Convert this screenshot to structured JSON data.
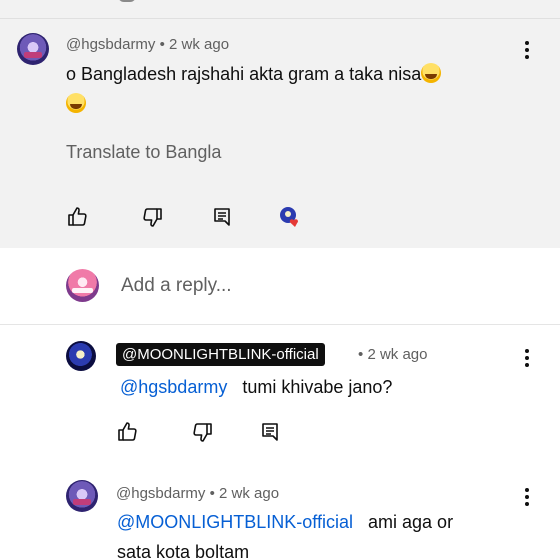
{
  "comment": {
    "author": "@hgsbdarmy",
    "time": "2 wk ago",
    "text_line1": "o Bangladesh rajshahi akta gram a taka nisa",
    "translate": "Translate to Bangla"
  },
  "reply_box": {
    "placeholder": "Add a reply..."
  },
  "replies": [
    {
      "author": "@MOONLIGHTBLINK-official",
      "time": "2 wk ago",
      "mention": "@hgsbdarmy",
      "text": "tumi khivabe jano?"
    },
    {
      "author": "@hgsbdarmy",
      "time": "2 wk ago",
      "mention": "@MOONLIGHTBLINK-official",
      "text": "ami aga or",
      "text_line2": "sata kota boltam"
    }
  ],
  "separator": "•",
  "icons": [
    "like-icon",
    "dislike-icon",
    "reply-icon",
    "creator-heart-icon",
    "more-options-icon"
  ]
}
